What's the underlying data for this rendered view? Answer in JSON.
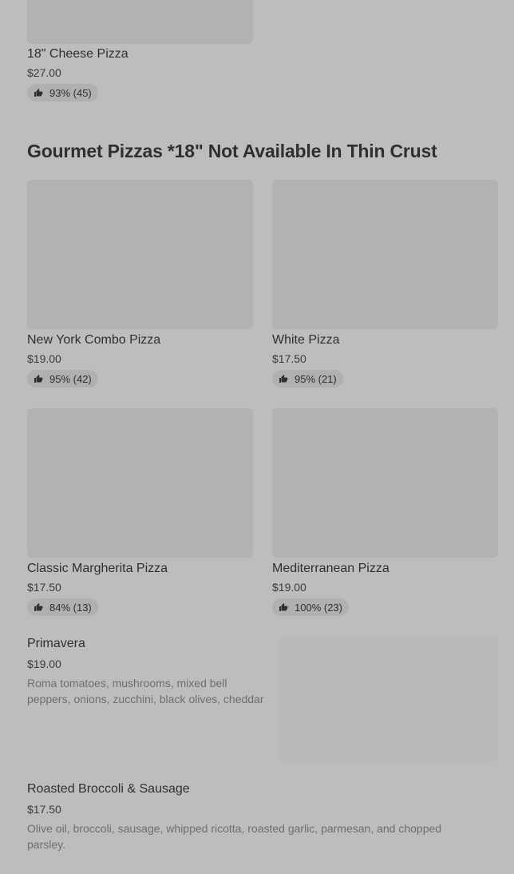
{
  "items": {
    "cheese18": {
      "title": "18\" Cheese Pizza",
      "price": "$27.00",
      "rating": "93% (45)"
    },
    "ny_combo": {
      "title": "New York Combo Pizza",
      "price": "$19.00",
      "rating": "95% (42)"
    },
    "white": {
      "title": "White Pizza",
      "price": "$17.50",
      "rating": "95% (21)"
    },
    "margherita": {
      "title": "Classic Margherita Pizza",
      "price": "$17.50",
      "rating": "84% (13)"
    },
    "mediterranean": {
      "title": "Mediterranean Pizza",
      "price": "$19.00",
      "rating": "100% (23)"
    },
    "primavera": {
      "title": "Primavera",
      "price": "$19.00",
      "description": "Roma tomatoes, mushrooms, mixed bell peppers, onions, zucchini, black olives, cheddar"
    },
    "broccoli_sausage": {
      "title": "Roasted Broccoli & Sausage",
      "price": "$17.50",
      "description": "Olive oil, broccoli, sausage, whipped ricotta, roasted garlic, parmesan, and chopped parsley."
    }
  },
  "section": {
    "heading": "Gourmet Pizzas *18\" Not Available In Thin Crust"
  },
  "icons": {
    "rating": "thumbs-up-icon"
  }
}
